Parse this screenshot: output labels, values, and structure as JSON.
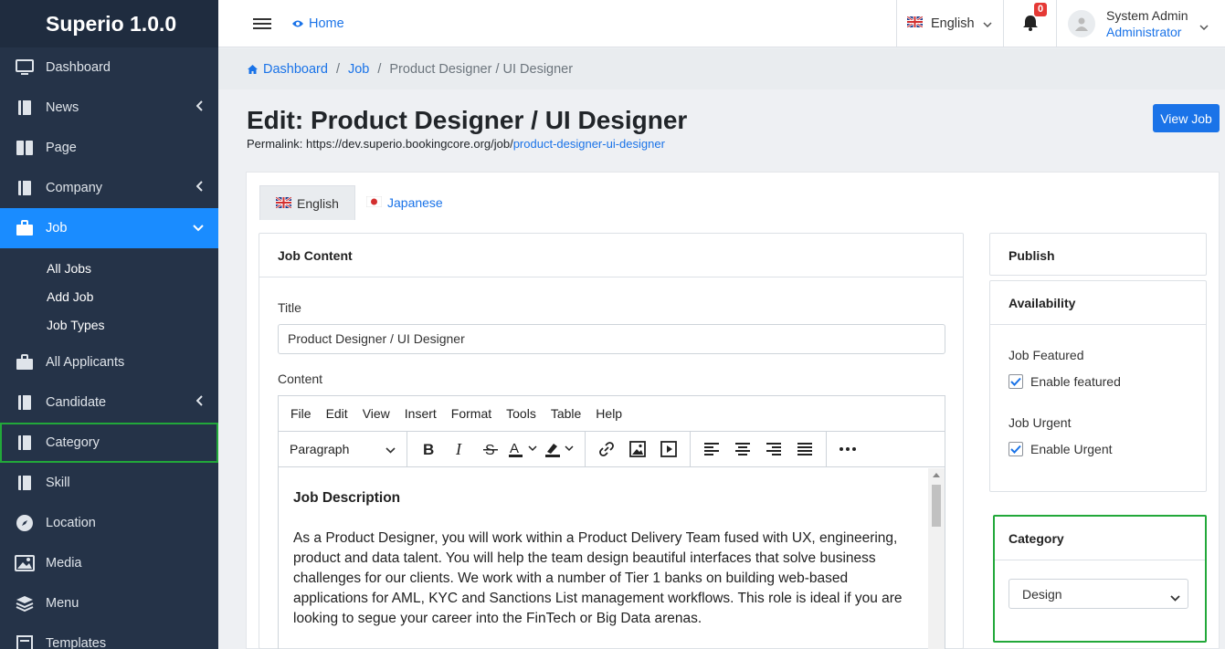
{
  "app": {
    "brand": "Superio 1.0.0"
  },
  "sidebar": {
    "items": [
      {
        "label": "Dashboard",
        "icon": "monitor-icon"
      },
      {
        "label": "News",
        "icon": "book-icon"
      },
      {
        "label": "Page",
        "icon": "pages-icon"
      },
      {
        "label": "Company",
        "icon": "book-icon"
      },
      {
        "label": "Job",
        "icon": "briefcase-icon"
      },
      {
        "label": "All Applicants",
        "icon": "briefcase-icon"
      },
      {
        "label": "Candidate",
        "icon": "book-icon"
      },
      {
        "label": "Category",
        "icon": "book-icon"
      },
      {
        "label": "Skill",
        "icon": "book-icon"
      },
      {
        "label": "Location",
        "icon": "compass-icon"
      },
      {
        "label": "Media",
        "icon": "image-icon"
      },
      {
        "label": "Menu",
        "icon": "layers-icon"
      },
      {
        "label": "Templates",
        "icon": "template-icon"
      }
    ],
    "job_sub": [
      "All Jobs",
      "Add Job",
      "Job Types"
    ]
  },
  "topbar": {
    "home_label": "Home",
    "language": "English",
    "notification_count": "0",
    "user_name": "System Admin",
    "user_role": "Administrator"
  },
  "breadcrumb": {
    "items": [
      "Dashboard",
      "Job",
      "Product Designer / UI Designer"
    ]
  },
  "page": {
    "title": "Edit: Product Designer / UI Designer",
    "permalink_prefix": "Permalink: https://dev.superio.bookingcore.org/job/",
    "permalink_slug": "product-designer-ui-designer",
    "view_button": "View Job"
  },
  "tabs": [
    "English",
    "Japanese"
  ],
  "job_content": {
    "header": "Job Content",
    "title_label": "Title",
    "title_value": "Product Designer / UI Designer",
    "content_label": "Content",
    "menu": [
      "File",
      "Edit",
      "View",
      "Insert",
      "Format",
      "Tools",
      "Table",
      "Help"
    ],
    "block_format": "Paragraph",
    "body_heading": "Job Description",
    "body_text": "As a Product Designer, you will work within a Product Delivery Team fused with UX, engineering, product and data talent. You will help the team design beautiful interfaces that solve business challenges for our clients. We work with a number of Tier 1 banks on building web-based applications for AML, KYC and Sanctions List management workflows. This role is ideal if you are looking to segue your career into the FinTech or Big Data arenas."
  },
  "publish": {
    "header": "Publish"
  },
  "availability": {
    "header": "Availability",
    "featured_label": "Job Featured",
    "featured_check": "Enable featured",
    "urgent_label": "Job Urgent",
    "urgent_check": "Enable Urgent"
  },
  "category": {
    "header": "Category",
    "selected": "Design"
  },
  "colors": {
    "sidebar_bg": "#253348",
    "accent": "#1a8cff",
    "highlight_border": "#22a83a",
    "badge": "#e53935"
  }
}
